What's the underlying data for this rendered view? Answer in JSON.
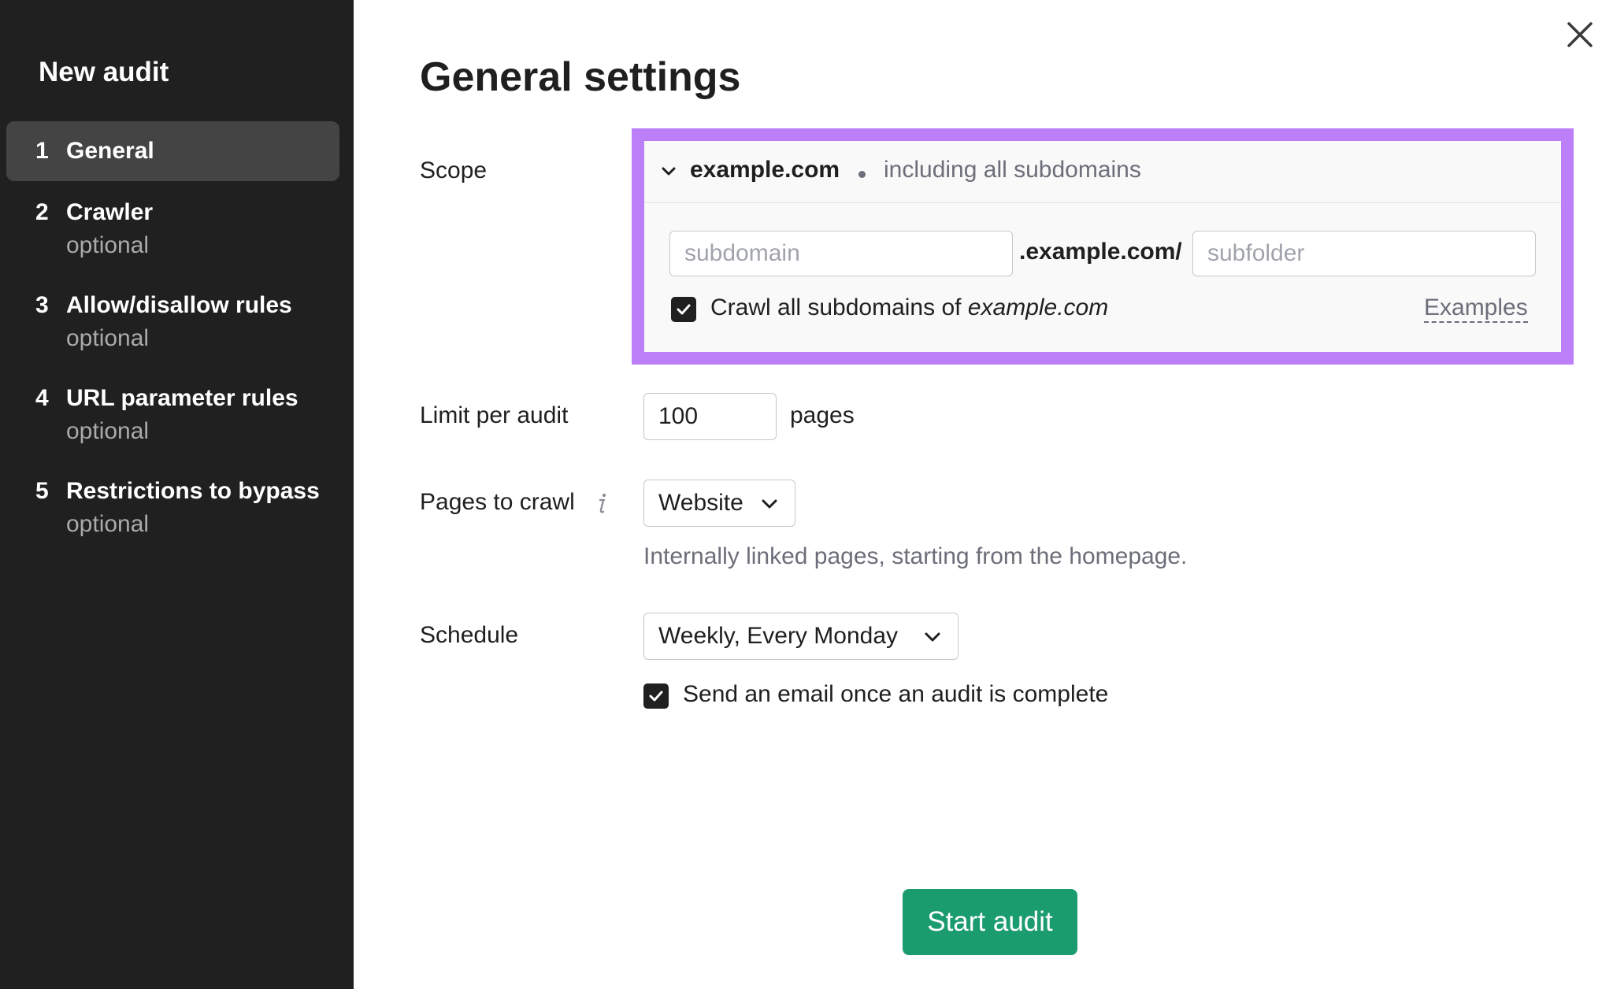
{
  "sidebar": {
    "title": "New audit",
    "steps": [
      {
        "number": "1",
        "label": "General",
        "sub": "",
        "active": true
      },
      {
        "number": "2",
        "label": "Crawler",
        "sub": "optional",
        "active": false
      },
      {
        "number": "3",
        "label": "Allow/disallow rules",
        "sub": "optional",
        "active": false
      },
      {
        "number": "4",
        "label": "URL parameter rules",
        "sub": "optional",
        "active": false
      },
      {
        "number": "5",
        "label": "Restrictions to bypass",
        "sub": "optional",
        "active": false
      }
    ]
  },
  "main": {
    "title": "General settings",
    "close_icon": "close-icon",
    "scope": {
      "label": "Scope",
      "domain": "example.com",
      "note": "including all subdomains",
      "subdomain_placeholder": "subdomain",
      "subdomain_value": "",
      "domain_suffix": ".example.com/",
      "subfolder_placeholder": "subfolder",
      "subfolder_value": "",
      "crawl_all_prefix": "Crawl all subdomains of",
      "crawl_all_domain": "example.com",
      "crawl_all_checked": true,
      "examples_link": "Examples"
    },
    "limit": {
      "label": "Limit per audit",
      "value": "100",
      "unit": "pages"
    },
    "pages_to_crawl": {
      "label": "Pages to crawl",
      "info_icon": "info-icon",
      "selected": "Website",
      "hint": "Internally linked pages, starting from the homepage."
    },
    "schedule": {
      "label": "Schedule",
      "selected": "Weekly, Every Monday",
      "email_label": "Send an email once an audit is complete",
      "email_checked": true
    },
    "start_button": "Start audit"
  },
  "colors": {
    "sidebar_bg": "#1f201f",
    "active_step_bg": "#444444",
    "highlight_border": "#bd7ff8",
    "primary_button": "#1b9c6f",
    "muted_text": "#6c6e79"
  }
}
